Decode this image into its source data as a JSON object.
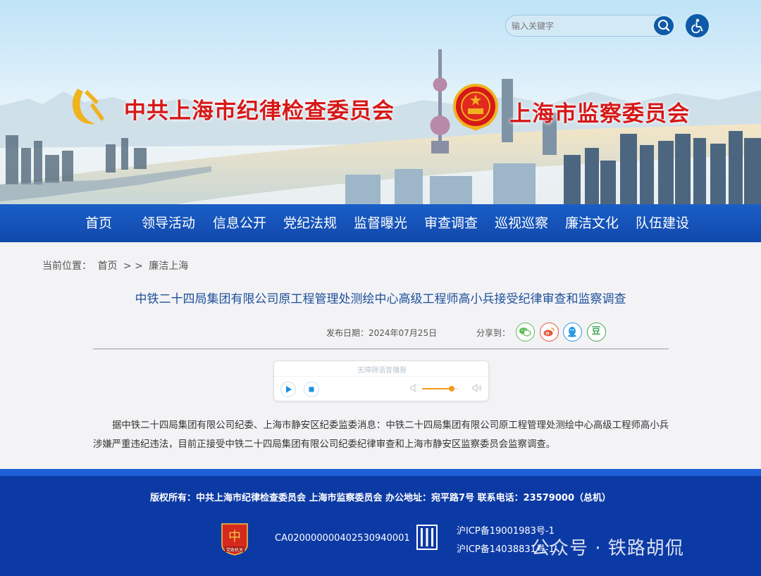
{
  "header": {
    "title_left": "中共上海市纪律检查委员会",
    "title_right": "上海市监察委员会",
    "search": {
      "placeholder": "输入关键字"
    }
  },
  "nav": {
    "items": [
      {
        "label": "首页"
      },
      {
        "label": "领导活动"
      },
      {
        "label": "信息公开"
      },
      {
        "label": "党纪法规"
      },
      {
        "label": "监督曝光"
      },
      {
        "label": "审查调查"
      },
      {
        "label": "巡视巡察"
      },
      {
        "label": "廉洁文化"
      },
      {
        "label": "队伍建设"
      }
    ]
  },
  "breadcrumb": {
    "prefix": "当前位置：",
    "home": "首页",
    "sep": "> >",
    "current": "廉洁上海"
  },
  "article": {
    "title": "中铁二十四局集团有限公司原工程管理处测绘中心高级工程师高小兵接受纪律审查和监察调查",
    "date_label": "发布日期：2024年07月25日",
    "share_label": "分享到：",
    "share_icons": [
      "wechat-icon",
      "weibo-icon",
      "qq-icon",
      "douban-icon"
    ],
    "douban_glyph": "豆",
    "body": "据中铁二十四局集团有限公司纪委、上海市静安区纪委监委消息：中铁二十四局集团有限公司原工程管理处测绘中心高级工程师高小兵涉嫌严重违纪违法，目前正接受中铁二十四局集团有限公司纪委纪律审查和上海市静安区监察委员会监察调查。"
  },
  "player": {
    "label": "无障碍语音播报",
    "volume": 0.8
  },
  "footer": {
    "copyright": "版权所有：中共上海市纪律检查委员会 上海市监察委员会 办公地址：宛平路7号 联系电话：23579000（总机）",
    "cert_no": "CA020000000402530940001",
    "icp1": "沪ICP备19001983号-1",
    "icp2": "沪ICP备14038831号-1",
    "badge_label": "党政机关",
    "watermark": "公众号 · 铁路胡侃"
  },
  "colors": {
    "nav_bg": "#1452b8",
    "title_red": "#d71818",
    "footer_bg": "#0c3aa5",
    "article_title": "#1e4f9a"
  }
}
